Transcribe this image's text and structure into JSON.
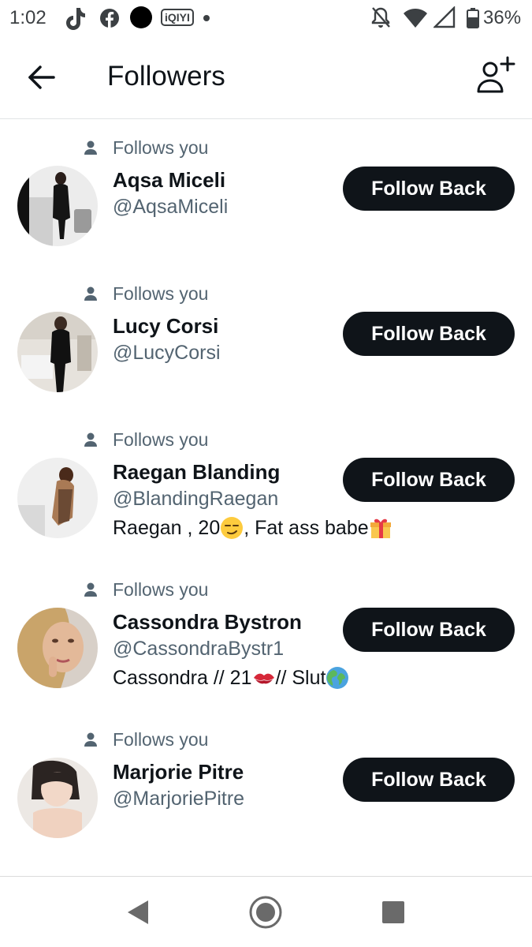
{
  "status_bar": {
    "time": "1:02",
    "battery": "36%",
    "iqiyi_label": "iQIYI"
  },
  "header": {
    "title": "Followers",
    "back_icon": "arrow-left-icon",
    "add_icon": "add-user-icon"
  },
  "followers": [
    {
      "follows_label": "Follows you",
      "name": "Aqsa Miceli",
      "handle": "@AqsaMiceli",
      "bio": "",
      "button": "Follow Back"
    },
    {
      "follows_label": "Follows you",
      "name": "Lucy Corsi",
      "handle": "@LucyCorsi",
      "bio": "",
      "button": "Follow Back"
    },
    {
      "follows_label": "Follows you",
      "name": "Raegan Blanding",
      "handle": "@BlandingRaegan",
      "bio_parts": [
        "Raegan , 20",
        " , Fat ass babe"
      ],
      "button": "Follow Back"
    },
    {
      "follows_label": "Follows you",
      "name": "Cassondra Bystron",
      "handle": "@CassondraBystr1",
      "bio_parts": [
        "Cassondra // 21",
        " // Slut"
      ],
      "button": "Follow Back"
    },
    {
      "follows_label": "Follows you",
      "name": "Marjorie Pitre",
      "handle": "@MarjoriePitre",
      "bio": "",
      "button": "Follow Back"
    }
  ],
  "colors": {
    "primary_text": "#0f1419",
    "secondary_text": "#536471",
    "button_bg": "#0f1419",
    "button_text": "#ffffff"
  }
}
